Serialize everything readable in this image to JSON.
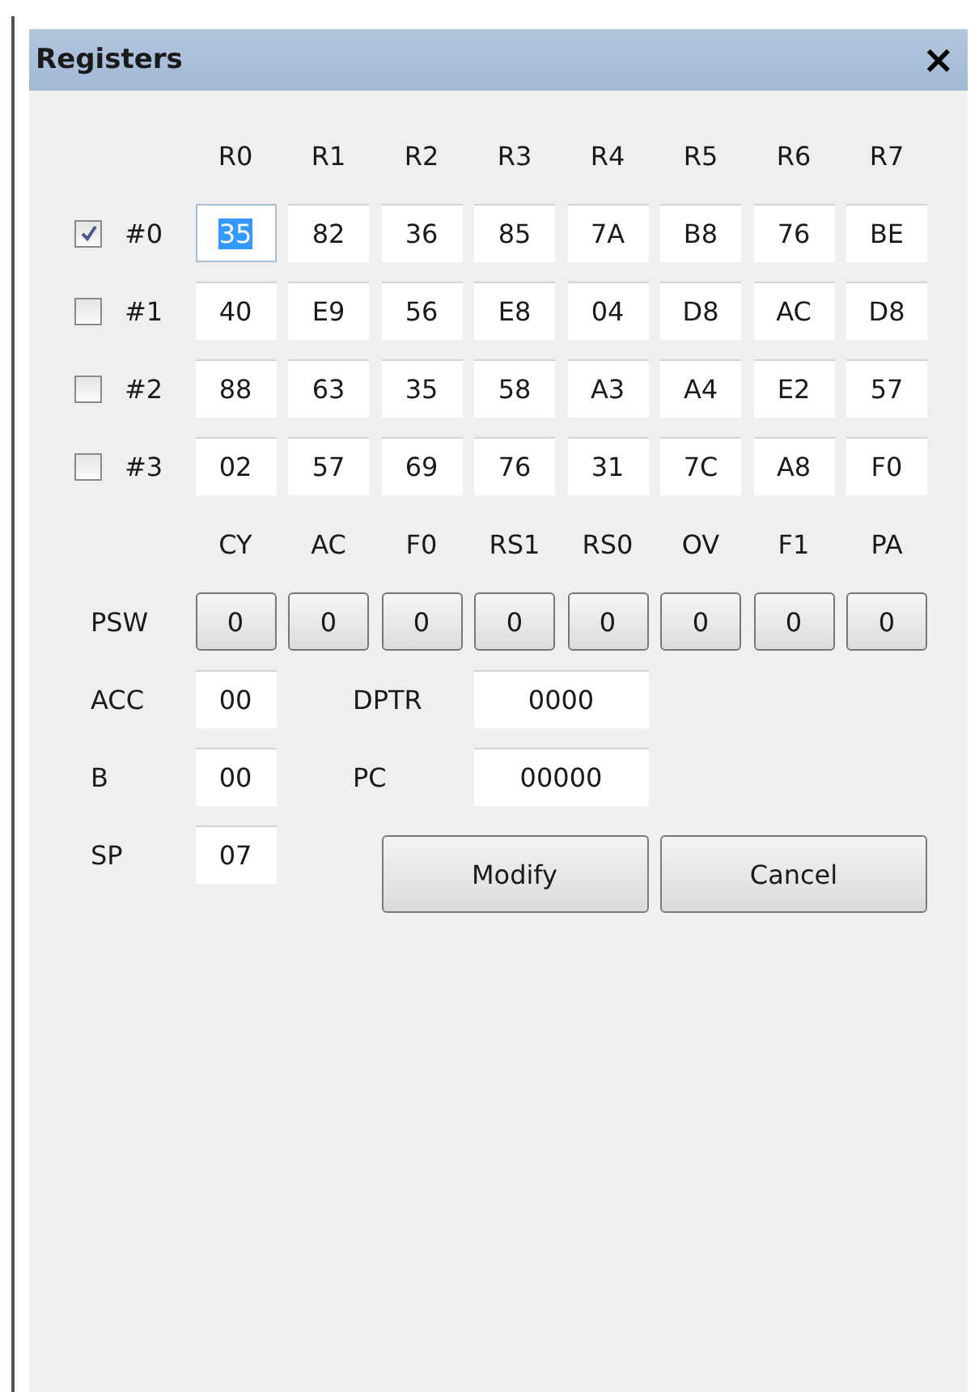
{
  "window": {
    "title": "Registers",
    "close": "×"
  },
  "register_headers": [
    "R0",
    "R1",
    "R2",
    "R3",
    "R4",
    "R5",
    "R6",
    "R7"
  ],
  "banks": [
    {
      "label": "#0",
      "checked": true,
      "cells": [
        {
          "value": "35",
          "selected": true
        },
        {
          "value": "82",
          "selected": false
        },
        {
          "value": "36",
          "selected": false
        },
        {
          "value": "85",
          "selected": false
        },
        {
          "value": "7A",
          "selected": false
        },
        {
          "value": "B8",
          "selected": false
        },
        {
          "value": "76",
          "selected": false
        },
        {
          "value": "BE",
          "selected": false
        }
      ]
    },
    {
      "label": "#1",
      "checked": false,
      "cells": [
        {
          "value": "40",
          "selected": false
        },
        {
          "value": "E9",
          "selected": false
        },
        {
          "value": "56",
          "selected": false
        },
        {
          "value": "E8",
          "selected": false
        },
        {
          "value": "04",
          "selected": false
        },
        {
          "value": "D8",
          "selected": false
        },
        {
          "value": "AC",
          "selected": false
        },
        {
          "value": "D8",
          "selected": false
        }
      ]
    },
    {
      "label": "#2",
      "checked": false,
      "cells": [
        {
          "value": "88",
          "selected": false
        },
        {
          "value": "63",
          "selected": false
        },
        {
          "value": "35",
          "selected": false
        },
        {
          "value": "58",
          "selected": false
        },
        {
          "value": "A3",
          "selected": false
        },
        {
          "value": "A4",
          "selected": false
        },
        {
          "value": "E2",
          "selected": false
        },
        {
          "value": "57",
          "selected": false
        }
      ]
    },
    {
      "label": "#3",
      "checked": false,
      "cells": [
        {
          "value": "02",
          "selected": false
        },
        {
          "value": "57",
          "selected": false
        },
        {
          "value": "69",
          "selected": false
        },
        {
          "value": "76",
          "selected": false
        },
        {
          "value": "31",
          "selected": false
        },
        {
          "value": "7C",
          "selected": false
        },
        {
          "value": "A8",
          "selected": false
        },
        {
          "value": "F0",
          "selected": false
        }
      ]
    }
  ],
  "psw": {
    "label": "PSW",
    "flag_headers": [
      "CY",
      "AC",
      "F0",
      "RS1",
      "RS0",
      "OV",
      "F1",
      "PA"
    ],
    "bits": [
      "0",
      "0",
      "0",
      "0",
      "0",
      "0",
      "0",
      "0"
    ]
  },
  "left_registers": [
    {
      "label": "ACC",
      "value": "00"
    },
    {
      "label": "B",
      "value": "00"
    },
    {
      "label": "SP",
      "value": "07"
    }
  ],
  "right_registers": [
    {
      "label": "DPTR",
      "value": "0000"
    },
    {
      "label": "PC",
      "value": "00000"
    }
  ],
  "buttons": [
    "Modify",
    "Cancel"
  ]
}
